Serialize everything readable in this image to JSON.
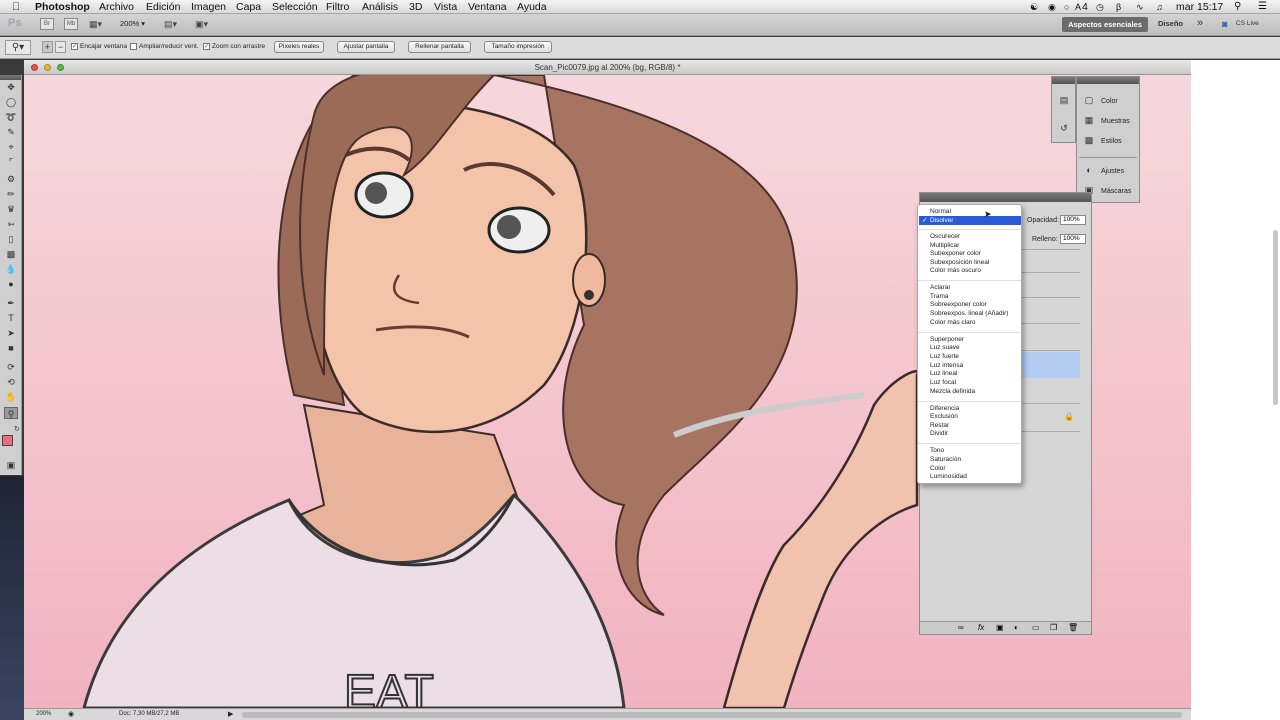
{
  "menubar": {
    "apple": "",
    "app": "Photoshop",
    "items": [
      "Archivo",
      "Edición",
      "Imagen",
      "Capa",
      "Selección",
      "Filtro",
      "Análisis",
      "3D",
      "Vista",
      "Ventana",
      "Ayuda"
    ],
    "clock": "mar 15:17",
    "battery_count": "4"
  },
  "appbar": {
    "ps_logo": "Ps",
    "br_label": "Br",
    "mb_label": "Mb",
    "zoom": "200%",
    "workspace_active": "Aspectos esenciales",
    "workspace_other": "Diseño",
    "more": "»",
    "cslive": "CS Live"
  },
  "options": {
    "fit_windows": "Encajar ventana",
    "resize_windows": "Ampliar/reducir vent.",
    "scrubby_zoom": "Zoom con arrastre",
    "btn_actual": "Píxeles reales",
    "btn_fit": "Ajustar pantalla",
    "btn_fill": "Rellenar pantalla",
    "btn_print": "Tamaño impresión"
  },
  "document": {
    "title": "Scan_Pic0079.jpg al 200% (bg, RGB/8) *",
    "shirt_text": "EAT",
    "status_zoom": "200%",
    "status_doc": "Doc: 7,30 MB/27,2 MB"
  },
  "panels": {
    "color": "Color",
    "swatches": "Muestras",
    "styles": "Estilos",
    "adjustments": "Ajustes",
    "masks": "Máscaras"
  },
  "layers": {
    "opacity_label": "Opacidad:",
    "opacity_value": "100%",
    "fill_label": "Relleno:",
    "fill_value": "100%"
  },
  "blend_menu": {
    "selected": "Disolver",
    "groups": [
      [
        "Normal",
        "Disolver"
      ],
      [
        "Oscurecer",
        "Multiplicar",
        "Subexponer color",
        "Subexposición lineal",
        "Color más oscuro"
      ],
      [
        "Aclarar",
        "Trama",
        "Sobreexponer color",
        "Sobreexpos. lineal (Añadir)",
        "Color más claro"
      ],
      [
        "Superponer",
        "Luz suave",
        "Luz fuerte",
        "Luz intensa",
        "Luz lineal",
        "Luz focal",
        "Mezcla definida"
      ],
      [
        "Diferencia",
        "Exclusión",
        "Restar",
        "Dividir"
      ],
      [
        "Tono",
        "Saturación",
        "Color",
        "Luminosidad"
      ]
    ]
  },
  "colors": {
    "foreground": "#e86b83",
    "background": "#ffffff",
    "highlight": "#2a5bd7"
  }
}
